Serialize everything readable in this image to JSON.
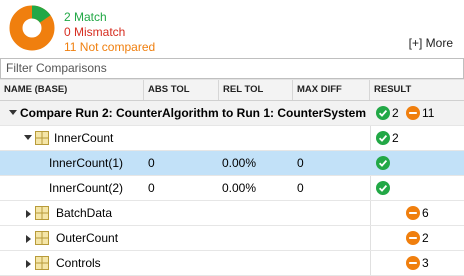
{
  "summary": {
    "match": "2 Match",
    "mismatch": "0 Mismatch",
    "not_compared": "11 Not compared",
    "more": "[+] More",
    "donut": {
      "match_fraction": 0.154,
      "not_compared_fraction": 0.846
    },
    "colors": {
      "match": "#22a846",
      "mismatch": "#d62d20",
      "not_compared": "#f07f0e"
    }
  },
  "filter": {
    "placeholder": "Filter Comparisons"
  },
  "columns": [
    "NAME (BASE)",
    "ABS TOL",
    "REL TOL",
    "MAX DIFF",
    "RESULT"
  ],
  "rows": {
    "run": {
      "name": "Compare Run 2: CounterAlgorithm to Run 1: CounterSystem",
      "pass_count": "2",
      "skip_count": "11"
    },
    "inner": {
      "name": "InnerCount",
      "pass_count": "2"
    },
    "inner1": {
      "name": "InnerCount(1)",
      "abs_tol": "0",
      "rel_tol": "0.00%",
      "max_diff": "0"
    },
    "inner2": {
      "name": "InnerCount(2)",
      "abs_tol": "0",
      "rel_tol": "0.00%",
      "max_diff": "0"
    },
    "batch": {
      "name": "BatchData",
      "skip_count": "6"
    },
    "outer": {
      "name": "OuterCount",
      "skip_count": "2"
    },
    "controls": {
      "name": "Controls",
      "skip_count": "3"
    }
  }
}
